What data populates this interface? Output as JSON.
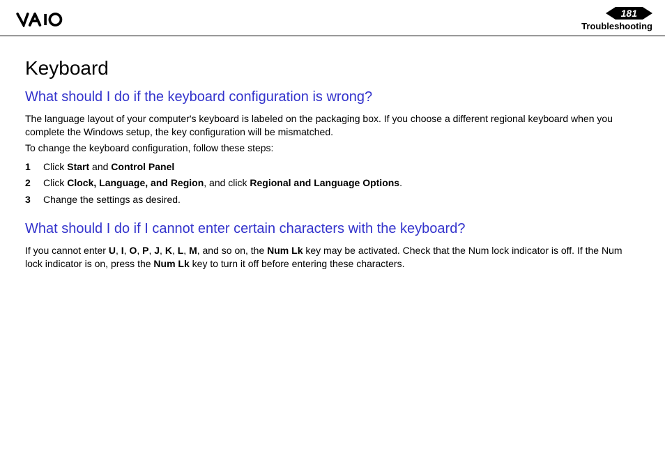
{
  "header": {
    "page_number": "181",
    "section": "Troubleshooting"
  },
  "content": {
    "title": "Keyboard",
    "q1": {
      "heading": "What should I do if the keyboard configuration is wrong?",
      "para1": "The language layout of your computer's keyboard is labeled on the packaging box. If you choose a different regional keyboard when you complete the Windows setup, the key configuration will be mismatched.",
      "para2": "To change the keyboard configuration, follow these steps:",
      "steps": [
        {
          "num": "1",
          "pre": "Click ",
          "b1": "Start",
          "mid": " and ",
          "b2": "Control Panel",
          "post": ""
        },
        {
          "num": "2",
          "pre": "Click ",
          "b1": "Clock, Language, and Region",
          "mid": ", and click ",
          "b2": "Regional and Language Options",
          "post": "."
        },
        {
          "num": "3",
          "pre": "Change the settings as desired.",
          "b1": "",
          "mid": "",
          "b2": "",
          "post": ""
        }
      ]
    },
    "q2": {
      "heading": "What should I do if I cannot enter certain characters with the keyboard?",
      "para_pre": "If you cannot enter ",
      "chars": [
        "U",
        "I",
        "O",
        "P",
        "J",
        "K",
        "L",
        "M"
      ],
      "para_mid1": ", and so on, the ",
      "numlk1": "Num Lk",
      "para_mid2": " key may be activated. Check that the Num lock indicator is off. If the Num lock indicator is on, press the ",
      "numlk2": "Num Lk",
      "para_post": " key to turn it off before entering these characters."
    }
  }
}
